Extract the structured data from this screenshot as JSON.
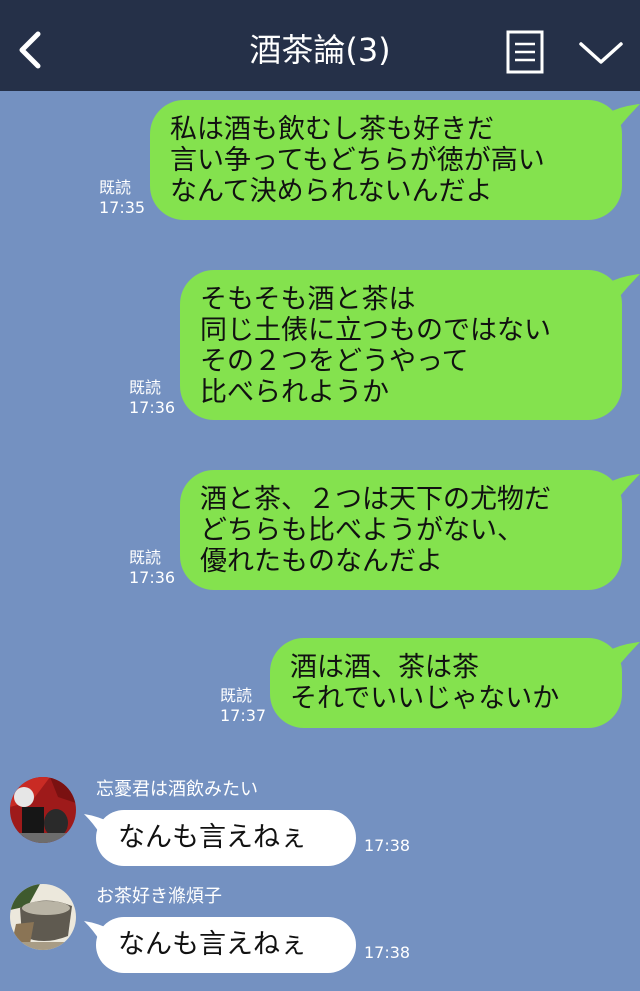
{
  "header": {
    "title": "酒茶論(3)",
    "back_icon": "chevron-left-icon",
    "menu_icon": "menu-lines-icon",
    "dropdown_icon": "chevron-down-icon"
  },
  "colors": {
    "background": "#7491c1",
    "header": "#253048",
    "outgoing_bubble": "#84e24e",
    "incoming_bubble": "#ffffff"
  },
  "messages": {
    "m1": {
      "text": "私は酒も飲むし茶も好きだ\n言い争ってもどちらが徳が高い\nなんて決められないんだよ",
      "read": "既読",
      "time": "17:35"
    },
    "m2": {
      "text": "そもそも酒と茶は\n同じ土俵に立つものではない\nその２つをどうやって\n比べられようか",
      "read": "既読",
      "time": "17:36"
    },
    "m3": {
      "text": "酒と茶、２つは天下の尤物だ\nどちらも比べようがない、\n優れたものなんだよ",
      "read": "既読",
      "time": "17:36"
    },
    "m4": {
      "text": "酒は酒、茶は茶\nそれでいいじゃないか",
      "read": "既読",
      "time": "17:37"
    },
    "m5": {
      "sender": "忘憂君は酒飲みたい",
      "text": "なんも言えねぇ",
      "time": "17:38"
    },
    "m6": {
      "sender": "お茶好き滌煩子",
      "text": "なんも言えねぇ",
      "time": "17:38"
    }
  }
}
